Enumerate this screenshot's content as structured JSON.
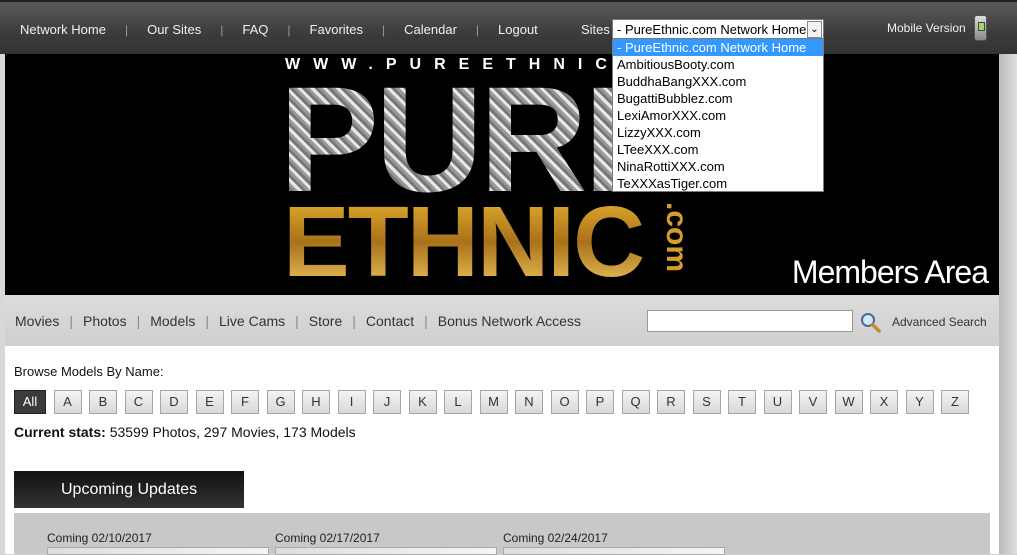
{
  "topnav": {
    "items": [
      "Network Home",
      "Our Sites",
      "FAQ",
      "Favorites",
      "Calendar",
      "Logout"
    ],
    "sites_label": "Sites",
    "sites_selected": "PureEthnic.com Network Home",
    "mobile_label": "Mobile Version"
  },
  "sites_dropdown": {
    "options": [
      "- PureEthnic.com Network Home",
      "AmbitiousBooty.com",
      "BuddhaBangXXX.com",
      "BugattiBubblez.com",
      "LexiAmorXXX.com",
      "LizzyXXX.com",
      "LTeeXXX.com",
      "NinaRottiXXX.com",
      "TeXXXasTiger.com"
    ]
  },
  "banner": {
    "url": "WWW.PUREETHNIC",
    "pure": "PURE",
    "ethnic": "ETHNIC",
    "dotcom": ".com",
    "members": "Members Area"
  },
  "mainnav": {
    "links": [
      "Movies",
      "Photos",
      "Models",
      "Live Cams",
      "Store",
      "Contact",
      "Bonus Network Access"
    ],
    "advanced_search": "Advanced Search"
  },
  "browse": {
    "label": "Browse Models By Name:",
    "letters": [
      "All",
      "A",
      "B",
      "C",
      "D",
      "E",
      "F",
      "G",
      "H",
      "I",
      "J",
      "K",
      "L",
      "M",
      "N",
      "O",
      "P",
      "Q",
      "R",
      "S",
      "T",
      "U",
      "V",
      "W",
      "X",
      "Y",
      "Z"
    ]
  },
  "stats": {
    "label": "Current stats:",
    "value": "53599 Photos, 297 Movies, 173 Models"
  },
  "upcoming": {
    "title": "Upcoming Updates",
    "dates": [
      "Coming 02/10/2017",
      "Coming 02/17/2017",
      "Coming 02/24/2017"
    ]
  }
}
